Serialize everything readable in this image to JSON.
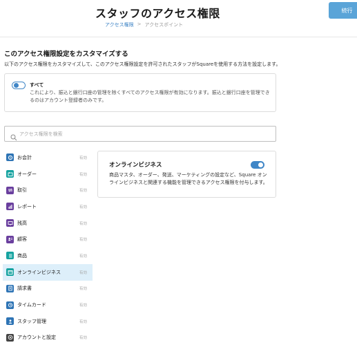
{
  "header": {
    "title": "スタッフのアクセス権限",
    "breadcrumb": [
      "アクセス権限",
      "アクセスポイント"
    ],
    "breadcrumb_separator": ">",
    "continue_label": "続行"
  },
  "section": {
    "title": "このアクセス権限設定をカスタマイズする",
    "description": "以下のアクセス権限をカスタマイズして、このアクセス権限設定を許可されたスタッフがSquareを使用する方法を設定します。"
  },
  "all_toggle": {
    "label": "すべて",
    "description": "これにより、振込と銀行口座の管理を除くすべてのアクセス権限が有効になります。振込と銀行口座を管理できるのはアカウント登録者のみです。",
    "enabled": false
  },
  "search": {
    "placeholder": "アクセス権限を検索"
  },
  "sidebar": {
    "items": [
      {
        "label": "お会計",
        "status": "有効",
        "icon": "payment-icon",
        "color": "#2e74b5"
      },
      {
        "label": "オーダー",
        "status": "有効",
        "icon": "orders-icon",
        "color": "#16a3a0"
      },
      {
        "label": "取引",
        "status": "有効",
        "icon": "transactions-icon",
        "color": "#6a3f9e"
      },
      {
        "label": "レポート",
        "status": "有効",
        "icon": "reports-icon",
        "color": "#6a3f9e"
      },
      {
        "label": "残高",
        "status": "有効",
        "icon": "balance-icon",
        "color": "#6a3f9e"
      },
      {
        "label": "顧客",
        "status": "有効",
        "icon": "customers-icon",
        "color": "#6a3f9e"
      },
      {
        "label": "商品",
        "status": "有効",
        "icon": "items-icon",
        "color": "#16a3a0"
      },
      {
        "label": "オンラインビジネス",
        "status": "有効",
        "icon": "online-business-icon",
        "color": "#16a3a0",
        "selected": true
      },
      {
        "label": "請求書",
        "status": "有効",
        "icon": "invoices-icon",
        "color": "#2e74b5"
      },
      {
        "label": "タイムカード",
        "status": "有効",
        "icon": "timecard-icon",
        "color": "#2e74b5"
      },
      {
        "label": "スタッフ管理",
        "status": "有効",
        "icon": "staff-icon",
        "color": "#2e74b5"
      },
      {
        "label": "アカウントと設定",
        "status": "有効",
        "icon": "settings-icon",
        "color": "#444444"
      }
    ]
  },
  "detail": {
    "title": "オンラインビジネス",
    "description": "商品マスタ、オーダー、発送、マーケティングの設定など、Square オンラインビジネスと関連する機能を管理できるアクセス権限を付与します。",
    "enabled": true
  },
  "colors": {
    "accent": "#3f86c7",
    "button": "#5aa4d8",
    "selected_bg": "#ddeffa"
  }
}
